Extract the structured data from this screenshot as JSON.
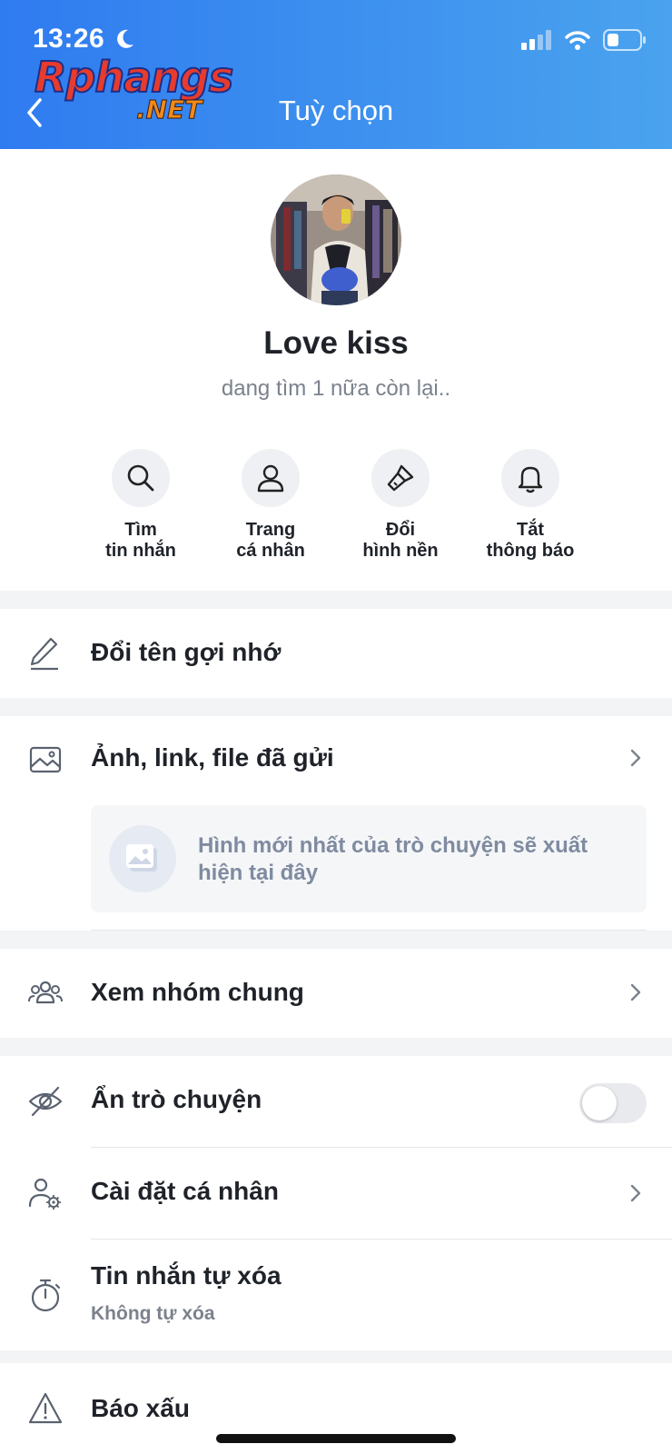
{
  "status_bar": {
    "time": "13:26"
  },
  "watermark": {
    "top": "Rphangs",
    "bottom": ".NET"
  },
  "header": {
    "title": "Tuỳ chọn"
  },
  "profile": {
    "name": "Love kiss",
    "status": "dang tìm 1 nữa còn lại.."
  },
  "actions": [
    {
      "line1": "Tìm",
      "line2": "tin nhắn",
      "icon": "search-icon"
    },
    {
      "line1": "Trang",
      "line2": "cá nhân",
      "icon": "user-icon"
    },
    {
      "line1": "Đổi",
      "line2": "hình nền",
      "icon": "paint-brush-icon"
    },
    {
      "line1": "Tắt",
      "line2": "thông báo",
      "icon": "bell-icon"
    }
  ],
  "rename": {
    "label": "Đổi tên gợi nhớ",
    "icon": "pencil-icon"
  },
  "media": {
    "label": "Ảnh, link, file đã gửi",
    "icon": "gallery-icon",
    "empty_text": "Hình mới nhất của trò chuyện sẽ xuất hiện tại đây"
  },
  "groups": {
    "label": "Xem nhóm chung",
    "icon": "group-icon"
  },
  "hide_chat": {
    "label": "Ẩn trò chuyện",
    "icon": "eye-off-icon",
    "enabled": false
  },
  "personal_settings": {
    "label": "Cài đặt cá nhân",
    "icon": "user-settings-icon"
  },
  "auto_delete": {
    "label": "Tin nhắn tự xóa",
    "value": "Không tự xóa",
    "icon": "timer-icon"
  },
  "report": {
    "label": "Báo xấu",
    "icon": "warning-icon"
  },
  "colors": {
    "header_start": "#2f7bf0",
    "header_end": "#4aa3ee"
  }
}
